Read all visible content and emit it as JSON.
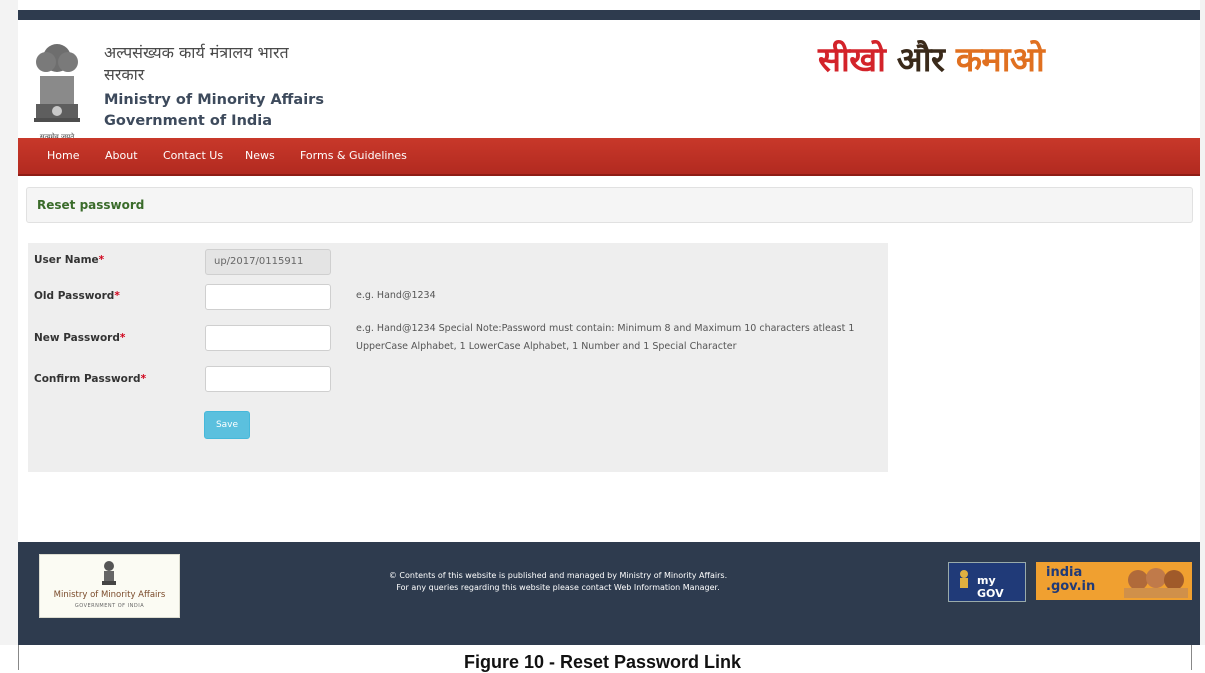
{
  "header": {
    "ministry_hindi": "अल्पसंख्यक कार्य मंत्रालय भारत सरकार",
    "ministry_en_line1": "Ministry of Minority Affairs",
    "ministry_en_line2": "Government of India",
    "emblem_motto": "सत्यमेव जयते",
    "slogan_part1": "सीखो",
    "slogan_part2": "और",
    "slogan_part3": "कमाओ"
  },
  "nav": {
    "items": [
      {
        "label": "Home"
      },
      {
        "label": "About"
      },
      {
        "label": "Contact Us"
      },
      {
        "label": "News"
      },
      {
        "label": "Forms & Guidelines"
      }
    ]
  },
  "panel": {
    "title": "Reset password"
  },
  "form": {
    "username_label": "User Name",
    "username_value": "up/2017/0115911",
    "old_password_label": "Old Password",
    "new_password_label": "New Password",
    "confirm_password_label": "Confirm Password",
    "required_mark": "*",
    "old_password_hint": "e.g. Hand@1234",
    "new_password_hint": "e.g. Hand@1234 Special Note:Password must contain: Minimum 8 and Maximum 10 characters atleast 1 UpperCase Alphabet, 1 LowerCase Alphabet, 1 Number and 1 Special Character",
    "save_label": "Save"
  },
  "footer": {
    "logo_name": "Ministry of Minority Affairs",
    "logo_sub": "GOVERNMENT OF INDIA",
    "line1": "© Contents of this website is published and managed by Ministry of Minority Affairs.",
    "line2": "For any queries regarding this website please contact Web Information Manager.",
    "mygov_label": "my GOV",
    "indiagov_label": "india .gov.in"
  },
  "caption": "Figure 10 - Reset Password Link",
  "colors": {
    "topbar": "#2e3b4e",
    "navbar": "#c0392b",
    "panel_title": "#3a6b2a",
    "save_button": "#5bc0de",
    "footer": "#2e3b4e",
    "required": "#d0021b"
  }
}
